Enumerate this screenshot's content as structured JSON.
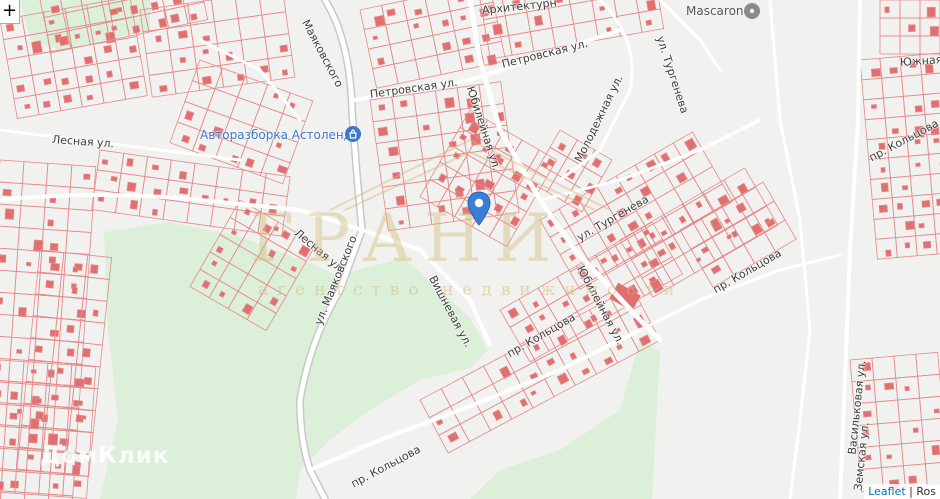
{
  "map": {
    "streets": [
      {
        "id": "arkhitektur",
        "label": "Архитектурн"
      },
      {
        "id": "mayakovskogo_top",
        "label": "Маяковского"
      },
      {
        "id": "petrovskaya_1",
        "label": "Петровская ул."
      },
      {
        "id": "petrovskaya_2",
        "label": "Петровская ул."
      },
      {
        "id": "yubileinaya_1",
        "label": "Юбилейная ул."
      },
      {
        "id": "molodezhnaya",
        "label": "Молодежная ул."
      },
      {
        "id": "turgeneva_1",
        "label": "ул. Тургенева"
      },
      {
        "id": "turgeneva_2",
        "label": "ул. Тургенева"
      },
      {
        "id": "yuzhnaya",
        "label": "Южная ул"
      },
      {
        "id": "koltsova_1",
        "label": "пр. Кольцова"
      },
      {
        "id": "koltsova_2",
        "label": "пр. Кольцова"
      },
      {
        "id": "koltsova_3",
        "label": "пр. Кольцова"
      },
      {
        "id": "koltsova_4",
        "label": "пр. Кольцова"
      },
      {
        "id": "lesnaya_1",
        "label": "Лесная ул."
      },
      {
        "id": "lesnaya_2",
        "label": "Лесная ул."
      },
      {
        "id": "mayakovskogo_main",
        "label": "ул. Маяковского"
      },
      {
        "id": "vishnevaya",
        "label": "Вишневая ул."
      },
      {
        "id": "yubileinaya_2",
        "label": "Юбилейная ул."
      },
      {
        "id": "vasilkovaya",
        "label": "Васильковая ул."
      },
      {
        "id": "zemskaya",
        "label": "Земская ул."
      }
    ],
    "pois": [
      {
        "id": "autoparts",
        "label": "Авторазборка Астоленд"
      },
      {
        "id": "mascaron",
        "label": "Mascaron"
      }
    ],
    "watermark": {
      "main": "ГРАНИ",
      "sub": "агентство недвижимости"
    },
    "brand": "ДомКлик",
    "zoom_in": "+",
    "attribution": {
      "link": "Leaflet",
      "separator": " | ",
      "rest": "Ros"
    },
    "colors": {
      "parcel": "#e58a8a",
      "building": "#e07070",
      "forest": "#dcefd9",
      "road": "#ffffff",
      "marker": "#3a7fd5"
    }
  }
}
